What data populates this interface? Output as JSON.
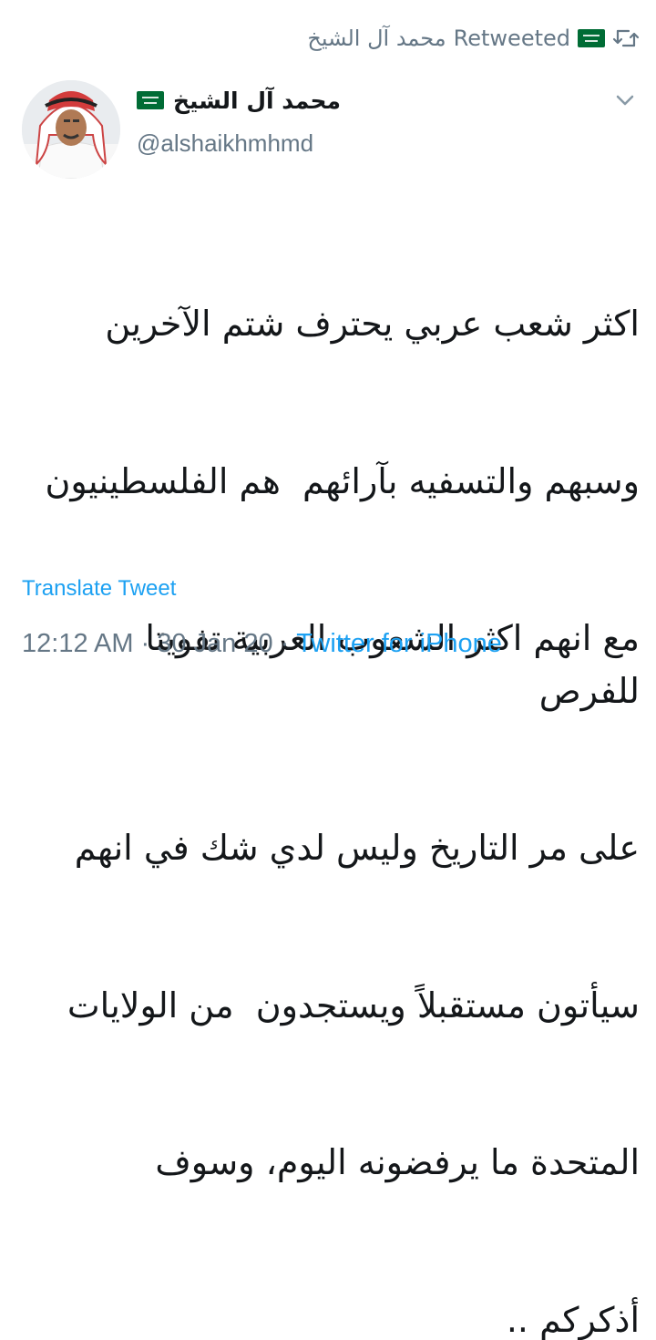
{
  "retweet": {
    "icon": "retweet-icon",
    "user": "محمد آل الشيخ",
    "label": "Retweeted",
    "flag_icon": "saudi-flag-icon"
  },
  "author": {
    "display_name": "محمد آل الشيخ",
    "handle": "@alshaikhmhmd",
    "avatar": "avatar-photo",
    "flag_icon": "saudi-flag-icon"
  },
  "menu_icon": "chevron-down-icon",
  "tweet": {
    "lines": [
      "اكثر شعب عربي يحترف شتم الآخرين",
      "وسبهم والتسفيه بآرائهم  هم الفلسطينيون",
      "مع انهم اكثر الشعوب العربية تفويتا للفرص",
      "على مر التاريخ وليس لدي شك في انهم",
      "سيأتون مستقبلاً ويستجدون  من الولايات",
      "المتحدة ما يرفضونه اليوم، وسوف",
      "أذكركم .."
    ]
  },
  "translate_label": "Translate Tweet",
  "meta": {
    "time": "12:12 AM",
    "sep1": "·",
    "date": "30 Jan 20",
    "sep2": "·",
    "source": "Twitter for iPhone"
  },
  "colors": {
    "link": "#1da1f2",
    "muted": "#657786",
    "text": "#14171a",
    "flag_green": "#006c35"
  }
}
